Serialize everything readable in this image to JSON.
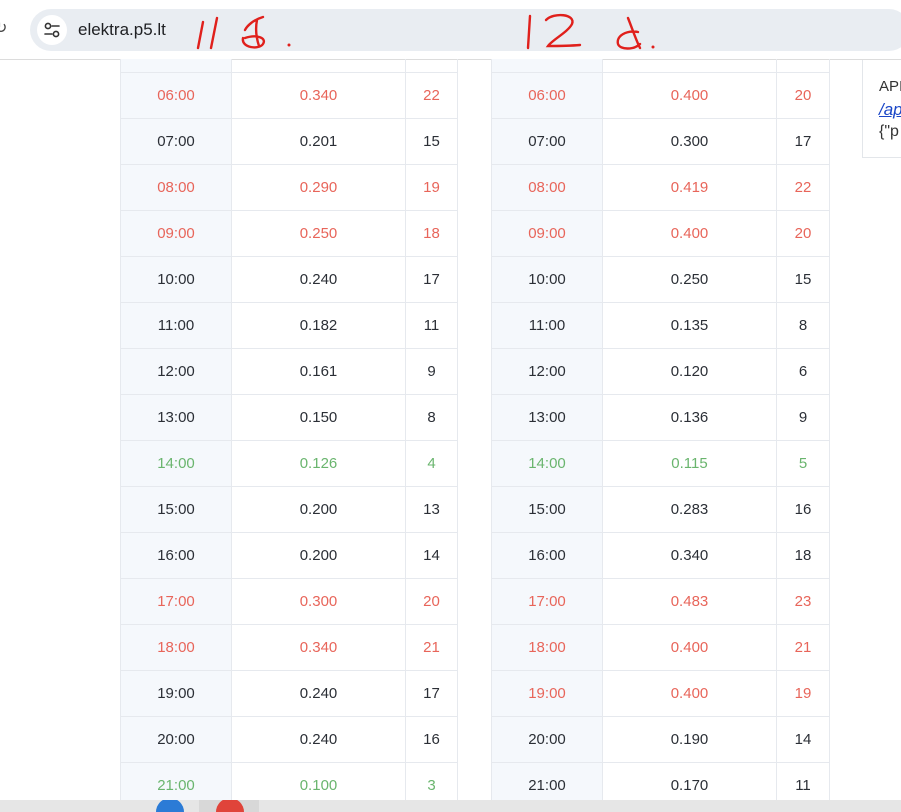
{
  "browser": {
    "url": "elektra.p5.lt",
    "annotations": [
      "11 d.",
      "12 d."
    ]
  },
  "tables": [
    {
      "rows": [
        {
          "time": "06:00",
          "price": "0.340",
          "rank": "22",
          "level": "high"
        },
        {
          "time": "07:00",
          "price": "0.201",
          "rank": "15",
          "level": "normal"
        },
        {
          "time": "08:00",
          "price": "0.290",
          "rank": "19",
          "level": "high"
        },
        {
          "time": "09:00",
          "price": "0.250",
          "rank": "18",
          "level": "high"
        },
        {
          "time": "10:00",
          "price": "0.240",
          "rank": "17",
          "level": "normal"
        },
        {
          "time": "11:00",
          "price": "0.182",
          "rank": "11",
          "level": "normal"
        },
        {
          "time": "12:00",
          "price": "0.161",
          "rank": "9",
          "level": "normal"
        },
        {
          "time": "13:00",
          "price": "0.150",
          "rank": "8",
          "level": "normal"
        },
        {
          "time": "14:00",
          "price": "0.126",
          "rank": "4",
          "level": "low"
        },
        {
          "time": "15:00",
          "price": "0.200",
          "rank": "13",
          "level": "normal"
        },
        {
          "time": "16:00",
          "price": "0.200",
          "rank": "14",
          "level": "normal"
        },
        {
          "time": "17:00",
          "price": "0.300",
          "rank": "20",
          "level": "high"
        },
        {
          "time": "18:00",
          "price": "0.340",
          "rank": "21",
          "level": "high"
        },
        {
          "time": "19:00",
          "price": "0.240",
          "rank": "17",
          "level": "normal"
        },
        {
          "time": "20:00",
          "price": "0.240",
          "rank": "16",
          "level": "normal"
        },
        {
          "time": "21:00",
          "price": "0.100",
          "rank": "3",
          "level": "low"
        }
      ]
    },
    {
      "rows": [
        {
          "time": "06:00",
          "price": "0.400",
          "rank": "20",
          "level": "high"
        },
        {
          "time": "07:00",
          "price": "0.300",
          "rank": "17",
          "level": "normal"
        },
        {
          "time": "08:00",
          "price": "0.419",
          "rank": "22",
          "level": "high"
        },
        {
          "time": "09:00",
          "price": "0.400",
          "rank": "20",
          "level": "high"
        },
        {
          "time": "10:00",
          "price": "0.250",
          "rank": "15",
          "level": "normal"
        },
        {
          "time": "11:00",
          "price": "0.135",
          "rank": "8",
          "level": "normal"
        },
        {
          "time": "12:00",
          "price": "0.120",
          "rank": "6",
          "level": "normal"
        },
        {
          "time": "13:00",
          "price": "0.136",
          "rank": "9",
          "level": "normal"
        },
        {
          "time": "14:00",
          "price": "0.115",
          "rank": "5",
          "level": "low"
        },
        {
          "time": "15:00",
          "price": "0.283",
          "rank": "16",
          "level": "normal"
        },
        {
          "time": "16:00",
          "price": "0.340",
          "rank": "18",
          "level": "normal"
        },
        {
          "time": "17:00",
          "price": "0.483",
          "rank": "23",
          "level": "high"
        },
        {
          "time": "18:00",
          "price": "0.400",
          "rank": "21",
          "level": "high"
        },
        {
          "time": "19:00",
          "price": "0.400",
          "rank": "19",
          "level": "high"
        },
        {
          "time": "20:00",
          "price": "0.190",
          "rank": "14",
          "level": "normal"
        },
        {
          "time": "21:00",
          "price": "0.170",
          "rank": "11",
          "level": "normal"
        }
      ]
    }
  ],
  "api_panel": {
    "label": "API",
    "link": "/ap",
    "json": "{\"p"
  },
  "icons": {
    "reload": "reload-icon",
    "site_info": "tune-icon"
  },
  "colors": {
    "high": "#e8655a",
    "low": "#6ab56e",
    "normal": "#2b2f36",
    "annotation": "#e0201c"
  }
}
